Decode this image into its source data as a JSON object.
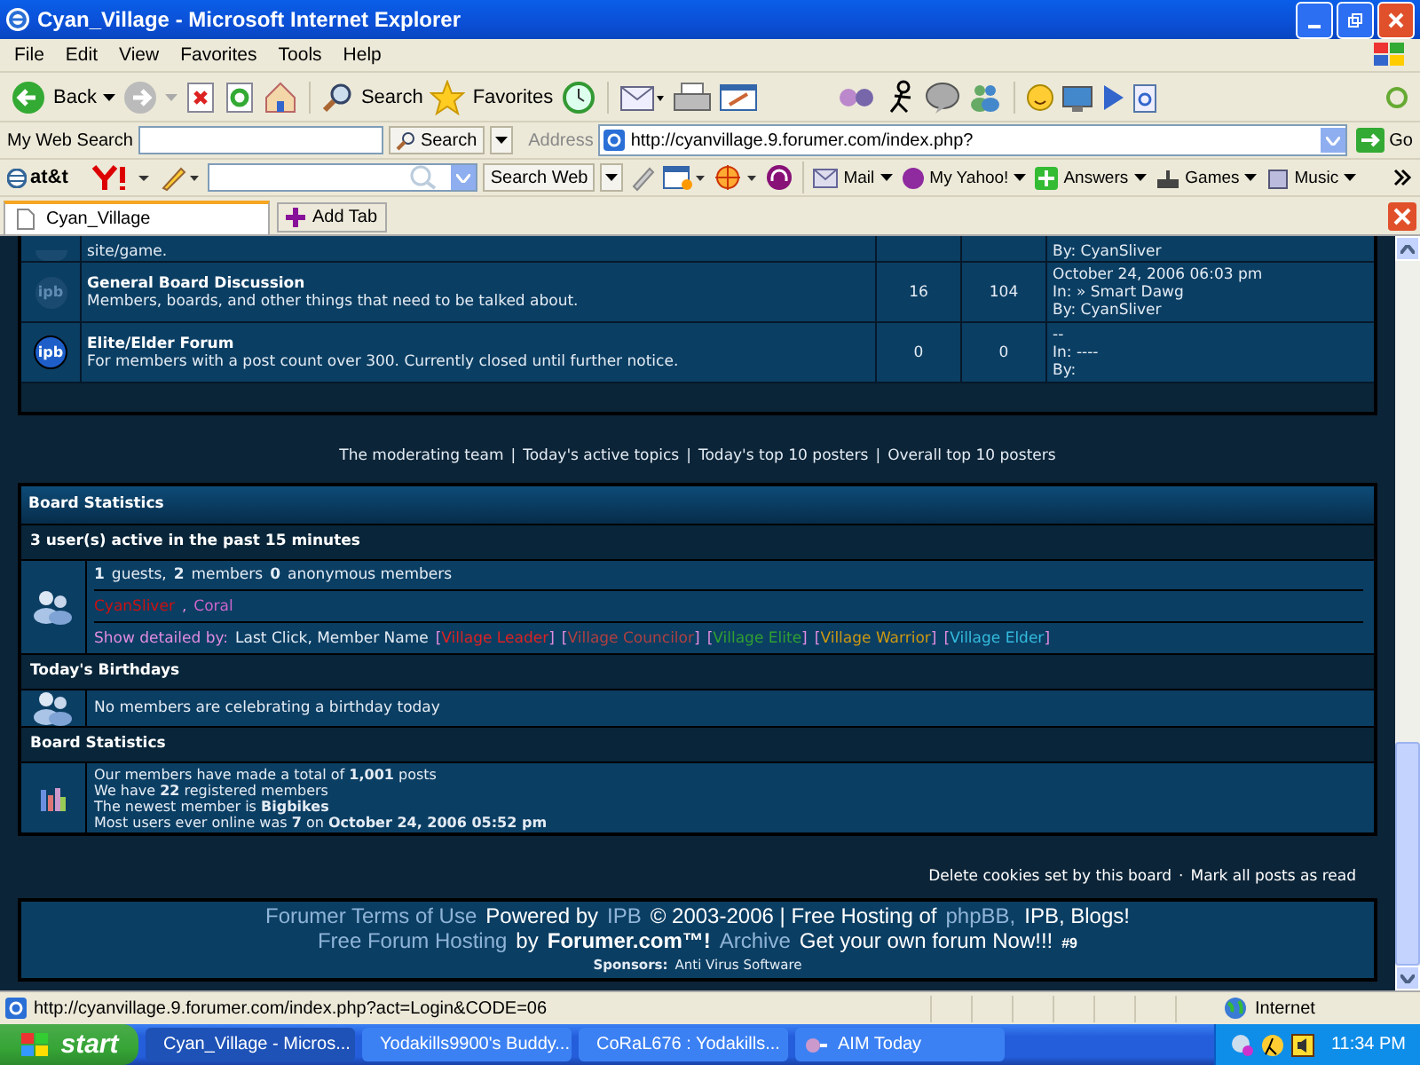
{
  "window": {
    "title": "Cyan_Village - Microsoft Internet Explorer"
  },
  "menu": [
    "File",
    "Edit",
    "View",
    "Favorites",
    "Tools",
    "Help"
  ],
  "toolbar": {
    "back": "Back",
    "search": "Search",
    "favorites": "Favorites"
  },
  "search_bar": {
    "label": "My Web Search",
    "button": "Search",
    "address_label": "Address",
    "url": "http://cyanvillage.9.forumer.com/index.php?",
    "go": "Go"
  },
  "yahoo_toolbar": {
    "brand": "at&t",
    "search_button": "Search Web",
    "items": [
      "Mail",
      "My Yahoo!",
      "Answers",
      "Games",
      "Music"
    ]
  },
  "tabs": [
    {
      "label": "Cyan_Village",
      "selected": true
    }
  ],
  "add_tab": "Add Tab",
  "forums": [
    {
      "description": "site/game.",
      "last_post": [
        "By: CyanSliver"
      ],
      "new_posts": false
    },
    {
      "icon_label": "ipb",
      "name": "General Board Discussion",
      "description": "Members, boards, and other things that need to be talked about.",
      "topics": "16",
      "replies": "104",
      "last_post": [
        "October 24, 2006 06:03 pm",
        "In: » Smart Dawg",
        "By: CyanSliver"
      ],
      "new_posts": false
    },
    {
      "icon_label": "ipb",
      "name": "Elite/Elder Forum",
      "description": "For members with a post count over 300. Currently closed until further notice.",
      "topics": "0",
      "replies": "0",
      "last_post": [
        "--",
        "In: ----",
        "By:"
      ],
      "new_posts": true
    }
  ],
  "links": [
    "The moderating team",
    "Today's active topics",
    "Today's top 10 posters",
    "Overall top 10 posters"
  ],
  "link_separator": "|",
  "stats": {
    "title": "Board Statistics",
    "active_header": "3 user(s) active in the past 15 minutes",
    "active_summary": "**1** guests, **2** members **0** anonymous members",
    "members": [
      {
        "name": "CyanSliver",
        "color": "#cc1111"
      },
      {
        "name": "Coral",
        "color": "#cc66cc"
      }
    ],
    "member_separator": " , ",
    "legend_label": "Show detailed by:",
    "legend_text": "Last Click, Member Name",
    "groups": [
      {
        "name": "Village Leader",
        "color": "#dd2222"
      },
      {
        "name": "Village Councilor",
        "color": "#b04040"
      },
      {
        "name": "Village Elite",
        "color": "#30a030"
      },
      {
        "name": "Village Warrior",
        "color": "#cc9911"
      },
      {
        "name": "Village Elder",
        "color": "#33bbdd"
      }
    ],
    "bracket_open": "[",
    "bracket_close": "]",
    "birthday_header": "Today's Birthdays",
    "birthday_text": "No members are celebrating a birthday today",
    "board_header": "Board Statistics",
    "board_lines": [
      "Our members have made a total of **1,001** posts",
      "We have **22** registered members",
      "The newest member is **Bigbikes**",
      "Most users ever online was **7** on **October 24, 2006 05:52 pm**"
    ]
  },
  "board_actions": [
    "Delete cookies set by this board",
    "Mark all posts as read"
  ],
  "action_separator": "·",
  "footer": {
    "lines": [
      [
        {
          "text": "Forumer Terms of Use",
          "kind": "link"
        },
        {
          "text": "Powered by",
          "kind": "text"
        },
        {
          "text": "IPB",
          "kind": "link"
        },
        {
          "text": "© 2003-2006 | Free Hosting of",
          "kind": "text"
        },
        {
          "text": "phpBB,",
          "kind": "link"
        },
        {
          "text": "IPB, Blogs!",
          "kind": "text"
        }
      ],
      [
        {
          "text": "Free Forum Hosting",
          "kind": "link"
        },
        {
          "text": "by",
          "kind": "text"
        },
        {
          "text": "Forumer.com™!",
          "kind": "strong"
        },
        {
          "text": "Archive",
          "kind": "link"
        },
        {
          "text": "Get your own forum Now!!!",
          "kind": "text"
        },
        {
          "text": "#9",
          "kind": "small"
        }
      ]
    ],
    "sponsors_label": "Sponsors:",
    "sponsor": "Anti Virus Software"
  },
  "status_bar": {
    "url": "http://cyanvillage.9.forumer.com/index.php?act=Login&CODE=06",
    "zone": "Internet"
  },
  "taskbar": {
    "start": "start",
    "tasks": [
      {
        "label": "Cyan_Village - Micros...",
        "selected": true
      },
      {
        "label": "Yodakills9900's Buddy...",
        "selected": false
      },
      {
        "label": "CoRaL676 : Yodakills...",
        "selected": false
      },
      {
        "label": "AIM Today",
        "selected": false
      }
    ],
    "clock": "11:34 PM"
  }
}
